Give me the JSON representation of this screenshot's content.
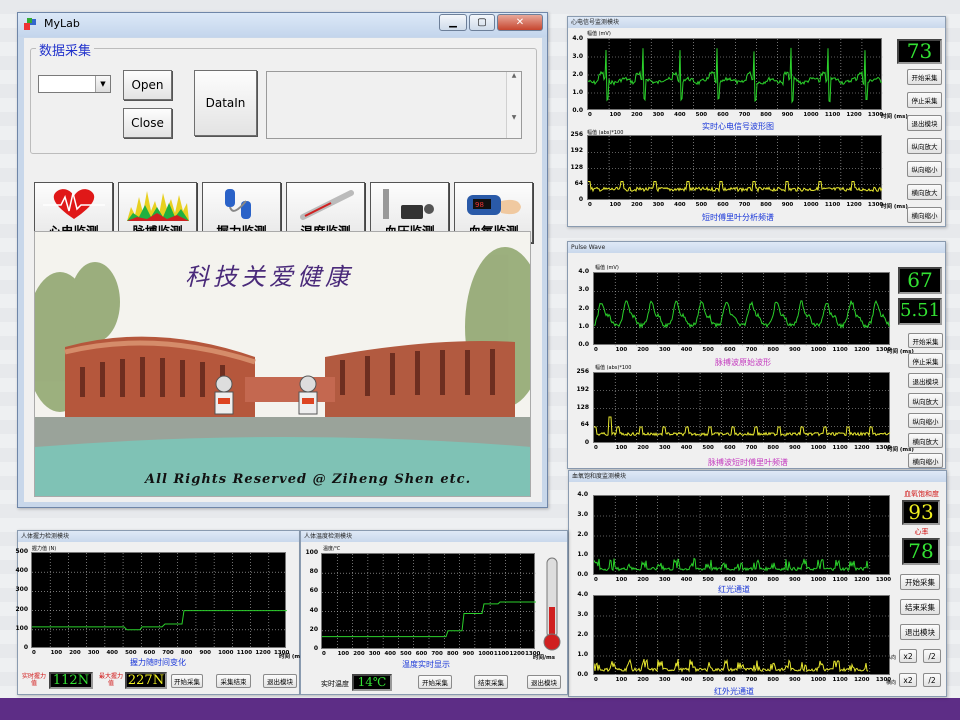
{
  "mylab": {
    "title": "MyLab",
    "group_title": "数据采集",
    "open_label": "Open",
    "close_label": "Close",
    "datain_label": "DataIn",
    "modules": [
      "心电监测",
      "脉搏监测",
      "握力监测",
      "温度监测",
      "血压监测",
      "血氧监测"
    ],
    "motto": "科技关爱健康",
    "copyright": "All Rights Reserved @ Ziheng Shen etc."
  },
  "ecg": {
    "title": "心电信号监测模块",
    "top_ylabel": "幅值 (mV)",
    "bottom_ylabel": "幅值 (abs)*100",
    "top_yticks": [
      "4.0",
      "3.0",
      "2.0",
      "1.0",
      "0.0"
    ],
    "bottom_yticks": [
      "256",
      "192",
      "128",
      "64",
      "0"
    ],
    "xticks": [
      "0",
      "100",
      "200",
      "300",
      "400",
      "500",
      "600",
      "700",
      "800",
      "900",
      "1000",
      "1100",
      "1200",
      "1300"
    ],
    "xunit": "时间 (ms)",
    "top_caption": "实时心电信号波形图",
    "bottom_caption": "短时傅里叶分析频谱",
    "value": "73",
    "buttons": [
      "开始采集",
      "停止采集",
      "退出模块",
      "纵向放大",
      "纵向缩小",
      "横向放大",
      "横向缩小"
    ]
  },
  "pulse": {
    "title": "Pulse Wave",
    "top_ylabel": "幅值 (mV)",
    "bottom_ylabel": "幅值 (abs)*100",
    "top_yticks": [
      "4.0",
      "3.0",
      "2.0",
      "1.0",
      "0.0"
    ],
    "bottom_yticks": [
      "256",
      "192",
      "128",
      "64",
      "0"
    ],
    "xticks": [
      "0",
      "100",
      "200",
      "300",
      "400",
      "500",
      "600",
      "700",
      "800",
      "900",
      "1000",
      "1100",
      "1200",
      "1300"
    ],
    "xunit": "时间 (ms)",
    "top_caption": "脉搏波原始波形",
    "bottom_caption": "脉搏波短时傅里叶频谱",
    "value": "67",
    "value2": "5.51",
    "buttons": [
      "开始采集",
      "停止采集",
      "退出模块",
      "纵向放大",
      "纵向缩小",
      "横向放大",
      "横向缩小"
    ]
  },
  "spo2": {
    "title": "血氧饱和度监测模块",
    "yticks": [
      "4.0",
      "3.0",
      "2.0",
      "1.0",
      "0.0"
    ],
    "xticks": [
      "0",
      "100",
      "200",
      "300",
      "400",
      "500",
      "600",
      "700",
      "800",
      "900",
      "1000",
      "1100",
      "1200",
      "1300"
    ],
    "top_caption": "红光通道",
    "bottom_caption": "红外光通道",
    "spo2_label": "血氧饱和度",
    "spo2_value": "93",
    "hr_label": "心率",
    "hr_value": "78",
    "buttons": [
      "开始采集",
      "结束采集",
      "退出模块"
    ],
    "zoom_v_label": "纵向",
    "zoom_h_label": "横向",
    "x2": "x2",
    "div2": "/2"
  },
  "grip": {
    "title": "人体握力检测模块",
    "ylabel": "握力值 (N)",
    "yticks": [
      "500",
      "400",
      "300",
      "200",
      "100",
      "0"
    ],
    "xticks": [
      "0",
      "100",
      "200",
      "300",
      "400",
      "500",
      "600",
      "700",
      "800",
      "900",
      "1000",
      "1100",
      "1200",
      "1300"
    ],
    "xunit": "时间 (ms)",
    "caption": "握力随时间变化",
    "realtime_label": "实时握力值",
    "realtime_value": "112N",
    "max_label": "最大握力值",
    "max_value": "227N",
    "buttons": [
      "开始采集",
      "采集结束",
      "退出模块"
    ]
  },
  "temp": {
    "title": "人体温度检测模块",
    "ylabel": "温度/℃",
    "yticks": [
      "100",
      "80",
      "60",
      "40",
      "20",
      "0"
    ],
    "xticks": [
      "0",
      "100",
      "200",
      "300",
      "400",
      "500",
      "600",
      "700",
      "800",
      "900",
      "1000",
      "1100",
      "1200",
      "1300"
    ],
    "xunit": "时间/ms",
    "caption": "温度实时显示",
    "realtime_label": "实时温度",
    "realtime_value": "14℃",
    "buttons": [
      "开始采集",
      "结束采集",
      "退出模块"
    ]
  }
}
